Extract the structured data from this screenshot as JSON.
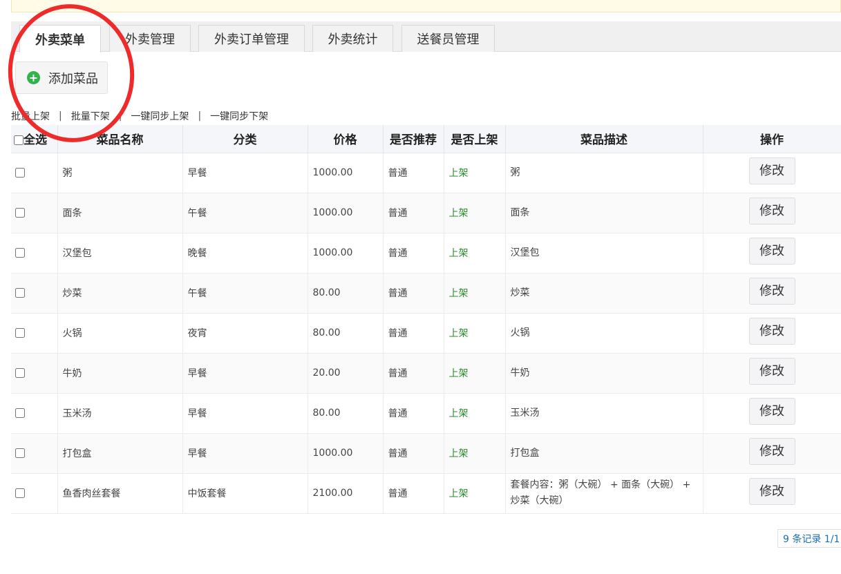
{
  "tabs": [
    {
      "label": "外卖菜单",
      "active": true
    },
    {
      "label": "外卖管理",
      "active": false
    },
    {
      "label": "外卖订单管理",
      "active": false
    },
    {
      "label": "外卖统计",
      "active": false
    },
    {
      "label": "送餐员管理",
      "active": false
    }
  ],
  "add_button": {
    "icon": "plus-circle-icon",
    "label": "添加菜品"
  },
  "batch_actions": [
    "批量上架",
    "批量下架",
    "一键同步上架",
    "一键同步下架"
  ],
  "table": {
    "headers": [
      "全选",
      "菜品名称",
      "分类",
      "价格",
      "是否推荐",
      "是否上架",
      "菜品描述",
      "操作"
    ],
    "rows": [
      {
        "name": "粥",
        "category": "早餐",
        "price": "1000.00",
        "recommend": "普通",
        "status": "上架",
        "desc": "粥",
        "action": "修改"
      },
      {
        "name": "面条",
        "category": "午餐",
        "price": "1000.00",
        "recommend": "普通",
        "status": "上架",
        "desc": "面条",
        "action": "修改"
      },
      {
        "name": "汉堡包",
        "category": "晚餐",
        "price": "1000.00",
        "recommend": "普通",
        "status": "上架",
        "desc": "汉堡包",
        "action": "修改"
      },
      {
        "name": "炒菜",
        "category": "午餐",
        "price": "80.00",
        "recommend": "普通",
        "status": "上架",
        "desc": "炒菜",
        "action": "修改"
      },
      {
        "name": "火锅",
        "category": "夜宵",
        "price": "80.00",
        "recommend": "普通",
        "status": "上架",
        "desc": "火锅",
        "action": "修改"
      },
      {
        "name": "牛奶",
        "category": "早餐",
        "price": "20.00",
        "recommend": "普通",
        "status": "上架",
        "desc": "牛奶",
        "action": "修改"
      },
      {
        "name": "玉米汤",
        "category": "早餐",
        "price": "80.00",
        "recommend": "普通",
        "status": "上架",
        "desc": "玉米汤",
        "action": "修改"
      },
      {
        "name": "打包盒",
        "category": "早餐",
        "price": "1000.00",
        "recommend": "普通",
        "status": "上架",
        "desc": "打包盒",
        "action": "修改"
      },
      {
        "name": "鱼香肉丝套餐",
        "category": "中饭套餐",
        "price": "2100.00",
        "recommend": "普通",
        "status": "上架",
        "desc": "套餐内容：粥（大碗） + 面条（大碗） + 炒菜（大碗）",
        "action": "修改"
      }
    ]
  },
  "pager": "9 条记录 1/1",
  "colors": {
    "status_on": "#2a8a2a",
    "annotation_circle": "#ee2a2a",
    "add_icon": "#2fb34a",
    "pager_text": "#1a6fb0"
  }
}
